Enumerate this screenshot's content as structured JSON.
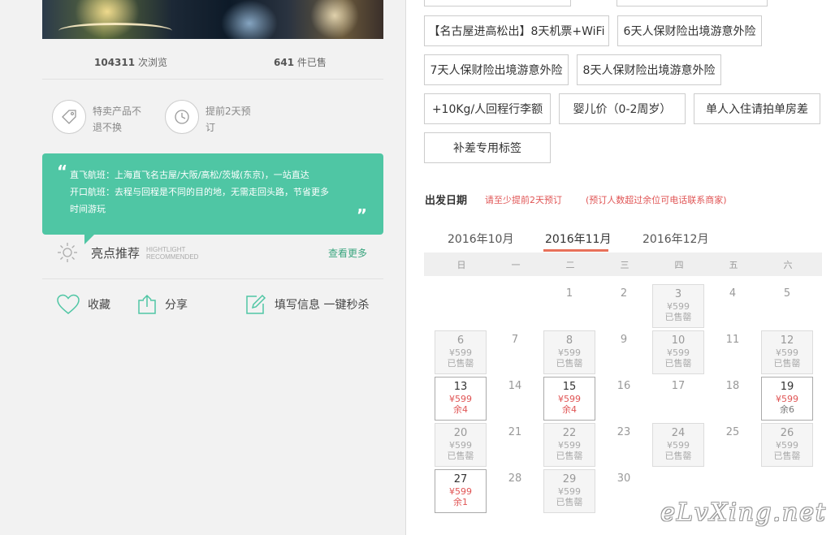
{
  "stats": {
    "views_num": "104311",
    "views_label": "次浏览",
    "sold_num": "641",
    "sold_label": "件已售"
  },
  "features": [
    {
      "icon": "tag-icon",
      "text": "特卖产品不退不换"
    },
    {
      "icon": "clock-icon",
      "text": "提前2天预订"
    }
  ],
  "quote": {
    "line1": "直飞航班：上海直飞名古屋/大阪/高松/茨城(东京)，一站直达",
    "line2": "开口航班：去程与回程是不同的目的地，无需走回头路，节省更多",
    "line3": "时间游玩"
  },
  "highlight": {
    "title": "亮点推荐",
    "sub1": "HIGHTLIGHT",
    "sub2": "RECOMMENDED",
    "more": "查看更多"
  },
  "actions": {
    "favorite": "收藏",
    "share": "分享",
    "fill": "填写信息 一键秒杀"
  },
  "tags": [
    "【名古屋进高松出】8天机票+WiFi",
    "6天人保财险出境游意外险",
    "7天人保财险出境游意外险",
    "8天人保财险出境游意外险",
    "+10Kg/人回程行李额",
    "婴儿价（0-2周岁）",
    "单人入住请拍单房差",
    "补差专用标签"
  ],
  "date_section": {
    "title": "出发日期",
    "note1": "请至少提前2天预订",
    "note2": "(预订人数超过余位可电话联系商家)"
  },
  "months": [
    "2016年10月",
    "2016年11月",
    "2016年12月"
  ],
  "active_month_index": 1,
  "weekdays": [
    "日",
    "一",
    "二",
    "三",
    "四",
    "五",
    "六"
  ],
  "calendar_days": [
    {
      "day": "1",
      "state": "plain"
    },
    {
      "day": "2",
      "state": "plain"
    },
    {
      "day": "3",
      "state": "soldout",
      "price": "¥599",
      "status": "已售罄"
    },
    {
      "day": "4",
      "state": "plain"
    },
    {
      "day": "5",
      "state": "plain"
    },
    {
      "day": "6",
      "state": "soldout",
      "price": "¥599",
      "status": "已售罄"
    },
    {
      "day": "7",
      "state": "plain"
    },
    {
      "day": "8",
      "state": "soldout",
      "price": "¥599",
      "status": "已售罄"
    },
    {
      "day": "9",
      "state": "plain"
    },
    {
      "day": "10",
      "state": "soldout",
      "price": "¥599",
      "status": "已售罄"
    },
    {
      "day": "11",
      "state": "plain"
    },
    {
      "day": "12",
      "state": "soldout",
      "price": "¥599",
      "status": "已售罄"
    },
    {
      "day": "13",
      "state": "available",
      "price": "¥599",
      "status": "余4",
      "status_color": "red"
    },
    {
      "day": "14",
      "state": "plain"
    },
    {
      "day": "15",
      "state": "available",
      "price": "¥599",
      "status": "余4",
      "status_color": "red"
    },
    {
      "day": "16",
      "state": "plain"
    },
    {
      "day": "17",
      "state": "plain"
    },
    {
      "day": "18",
      "state": "plain"
    },
    {
      "day": "19",
      "state": "available",
      "price": "¥599",
      "status": "余6",
      "status_color": "gray"
    },
    {
      "day": "20",
      "state": "soldout",
      "price": "¥599",
      "status": "已售罄"
    },
    {
      "day": "21",
      "state": "plain"
    },
    {
      "day": "22",
      "state": "soldout",
      "price": "¥599",
      "status": "已售罄"
    },
    {
      "day": "23",
      "state": "plain"
    },
    {
      "day": "24",
      "state": "soldout",
      "price": "¥599",
      "status": "已售罄"
    },
    {
      "day": "25",
      "state": "plain"
    },
    {
      "day": "26",
      "state": "soldout",
      "price": "¥599",
      "status": "已售罄"
    },
    {
      "day": "27",
      "state": "available",
      "price": "¥599",
      "status": "余1",
      "status_color": "red"
    },
    {
      "day": "28",
      "state": "plain"
    },
    {
      "day": "29",
      "state": "soldout",
      "price": "¥599",
      "status": "已售罄"
    },
    {
      "day": "30",
      "state": "plain"
    }
  ],
  "first_weekday_index": 2,
  "watermark": "eLvXing.net",
  "colors": {
    "accent_green": "#4fc6a4",
    "accent_red": "#e05555",
    "tab_underline": "#e8705a"
  }
}
